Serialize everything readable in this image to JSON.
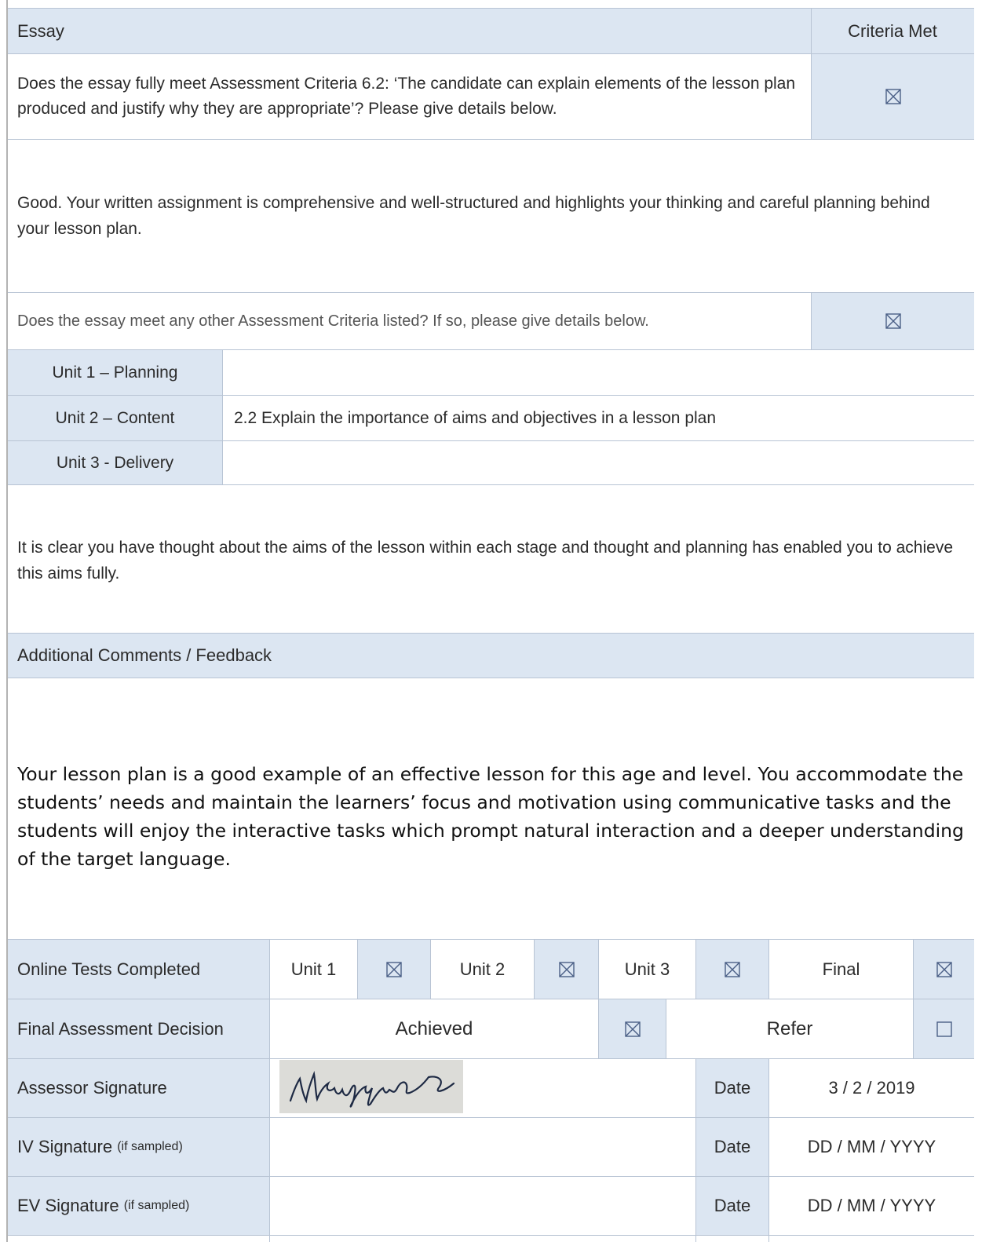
{
  "essay": {
    "header_label": "Essay",
    "criteria_met_label": "Criteria Met",
    "question_main": "Does the essay fully meet Assessment Criteria 6.2: ‘The candidate can explain elements of the lesson plan produced and justify why they are appropriate’? Please give details below.",
    "main_checked": true,
    "feedback_main": "Good. Your written assignment is comprehensive and well-structured and highlights your thinking and careful planning behind your lesson plan.",
    "question_other": "Does the essay meet any other Assessment Criteria listed? If so, please give details below.",
    "other_checked": true,
    "units": [
      {
        "label": "Unit 1 – Planning",
        "detail": ""
      },
      {
        "label": "Unit 2 – Content",
        "detail": "2.2 Explain the importance of aims and objectives in a lesson plan"
      },
      {
        "label": "Unit 3 - Delivery",
        "detail": ""
      }
    ],
    "feedback_other": "It is clear you have thought about the aims of the lesson within each stage and thought and planning has enabled you to achieve this aims fully."
  },
  "additional": {
    "header_label": "Additional Comments / Feedback",
    "text": "Your lesson plan is a good example of an effective lesson for this age and level. You accommodate the students’ needs and maintain the learners’ focus and motivation using communicative tasks and the students will enjoy the interactive tasks which prompt natural interaction and a deeper understanding of the target language."
  },
  "online_tests": {
    "label": "Online Tests Completed",
    "items": [
      {
        "label": "Unit 1",
        "checked": true
      },
      {
        "label": "Unit 2",
        "checked": true
      },
      {
        "label": "Unit 3",
        "checked": true
      },
      {
        "label": "Final",
        "checked": true
      }
    ]
  },
  "final_decision": {
    "label": "Final Assessment Decision",
    "achieved_label": "Achieved",
    "achieved_checked": true,
    "refer_label": "Refer",
    "refer_checked": false
  },
  "signatures": {
    "assessor_label": "Assessor Signature",
    "assessor_signature_text": "NRuggins",
    "assessor_date_label": "Date",
    "assessor_date": "3 / 2 / 2019",
    "iv_label": "IV Signature",
    "iv_note": "(if sampled)",
    "iv_date_label": "Date",
    "iv_date": "DD / MM / YYYY",
    "ev_label": "EV Signature",
    "ev_note": "(if sampled)",
    "ev_date_label": "Date",
    "ev_date": "DD / MM / YYYY"
  }
}
